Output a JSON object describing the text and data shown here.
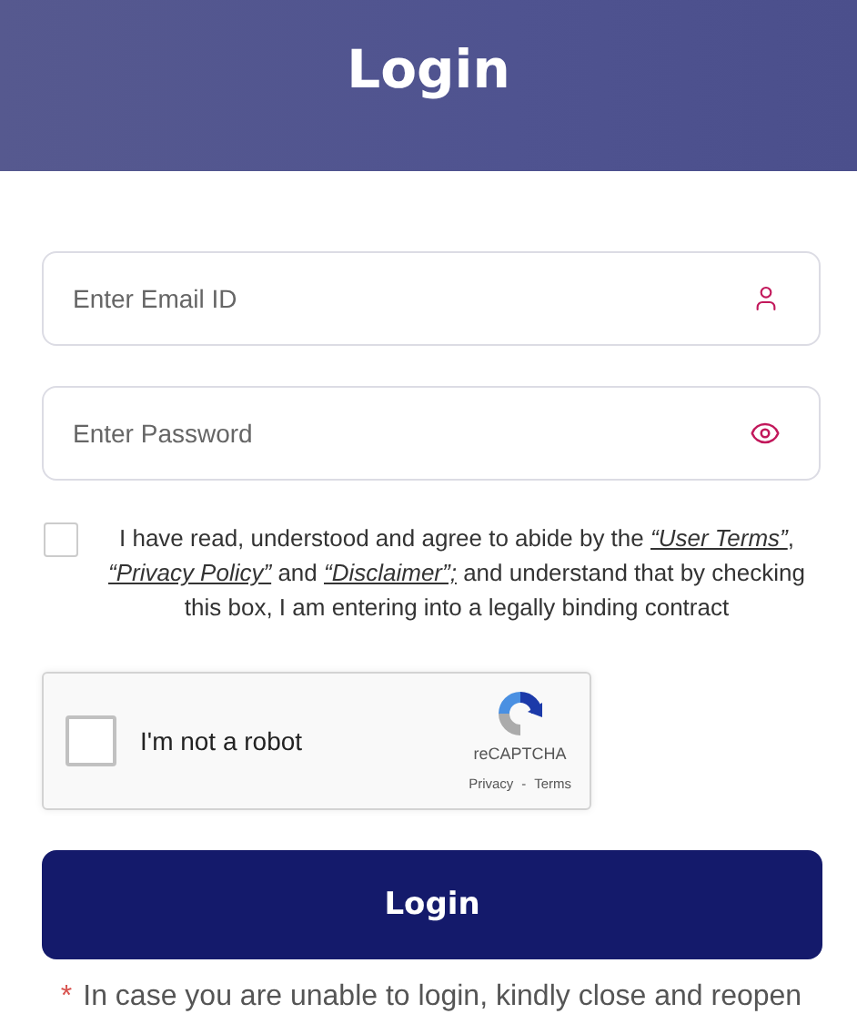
{
  "header": {
    "title": "Login"
  },
  "fields": [
    {
      "kind": "email",
      "placeholder": "Enter Email ID"
    },
    {
      "kind": "password",
      "placeholder": "Enter Password"
    }
  ],
  "agreement": {
    "checked": false,
    "parts": [
      {
        "kind": "text",
        "text": "I have read, understood and agree to abide by the "
      },
      {
        "kind": "link",
        "text": "“User Terms”"
      },
      {
        "kind": "text",
        "text": ", "
      },
      {
        "kind": "link",
        "text": "“Privacy Policy”"
      },
      {
        "kind": "text",
        "text": " and "
      },
      {
        "kind": "link",
        "text": "“Disclaimer”;"
      },
      {
        "kind": "text",
        "text": " and understand that by checking this box, I am entering into a legally binding contract"
      }
    ]
  },
  "captcha": {
    "checked": false,
    "label": "I'm not a robot",
    "brand": "reCAPTCHA",
    "privacy": "Privacy",
    "separator": "-",
    "terms": "Terms"
  },
  "submit": {
    "label": "Login"
  },
  "note": {
    "mark": "*",
    "text": "In case you are unable to login, kindly close and reopen"
  }
}
